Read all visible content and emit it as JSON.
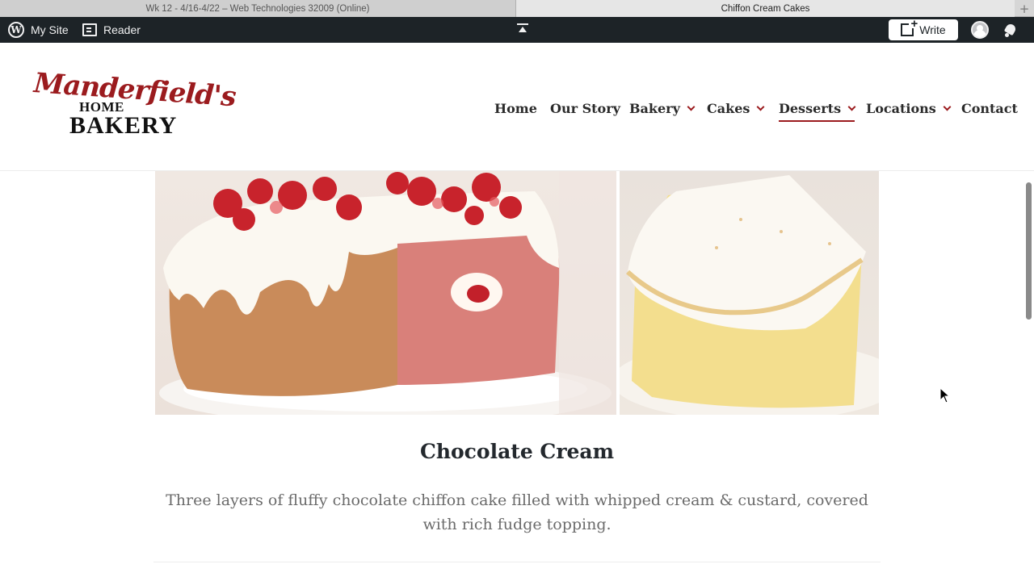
{
  "browser": {
    "tabs": [
      {
        "title": "Wk 12 - 4/16-4/22 – Web Technologies 32009 (Online)",
        "active": false
      },
      {
        "title": "Chiffon Cream Cakes",
        "active": true
      }
    ],
    "new_tab_icon": "plus-icon"
  },
  "admin_bar": {
    "my_site_label": "My Site",
    "reader_label": "Reader",
    "write_label": "Write",
    "icons": [
      "wordpress-icon",
      "reader-icon",
      "collapse-icon",
      "write-icon",
      "avatar",
      "notifications-icon"
    ]
  },
  "site": {
    "logo": {
      "script_text": "Manderfield's",
      "home_text": "HOME",
      "bakery_text": "BAKERY",
      "brand_color": "#9b1b1e"
    },
    "nav": [
      {
        "label": "Home",
        "has_dropdown": false,
        "active": false
      },
      {
        "label": "Our Story",
        "has_dropdown": false,
        "active": false
      },
      {
        "label": "Bakery",
        "has_dropdown": true,
        "active": false
      },
      {
        "label": "Cakes",
        "has_dropdown": true,
        "active": false
      },
      {
        "label": "Desserts",
        "has_dropdown": true,
        "active": true
      },
      {
        "label": "Locations",
        "has_dropdown": true,
        "active": false
      },
      {
        "label": "Contact",
        "has_dropdown": false,
        "active": false
      }
    ]
  },
  "product": {
    "title": "Chocolate Cream",
    "description": "Three layers of fluffy chocolate chiffon cake filled with whipped cream & custard, covered with rich fudge topping.",
    "images": [
      "strawberry-chiffon-cake-photo",
      "cream-cake-slice-photo"
    ]
  }
}
